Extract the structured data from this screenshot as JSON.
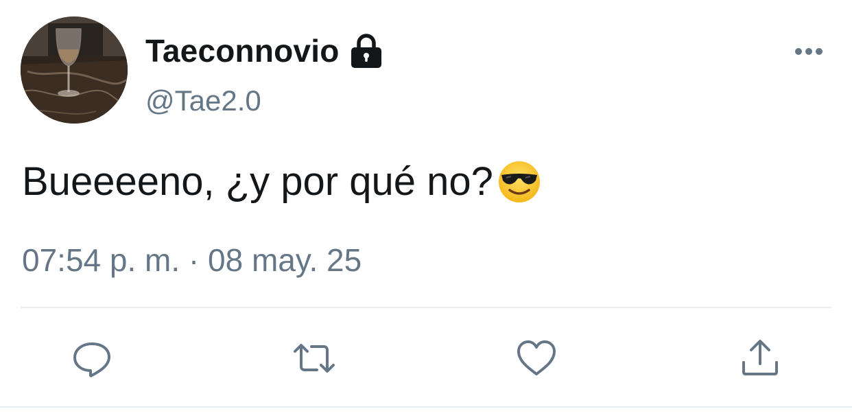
{
  "tweet": {
    "author": {
      "display_name": "Taeconnovio",
      "handle": "@Tae2.0",
      "protected": true,
      "avatar_icon": "wine-glass-avatar"
    },
    "text": "Bueeeeno, ¿y por qué no?",
    "emoji": "smiling-face-with-sunglasses",
    "timestamp": "07:54 p. m. · 08 may. 25",
    "actions": [
      "reply",
      "retweet",
      "like",
      "share"
    ]
  },
  "colors": {
    "primary_text": "#14171a",
    "secondary_text": "#657786",
    "divider": "#e6ecf0",
    "background": "#ffffff"
  }
}
